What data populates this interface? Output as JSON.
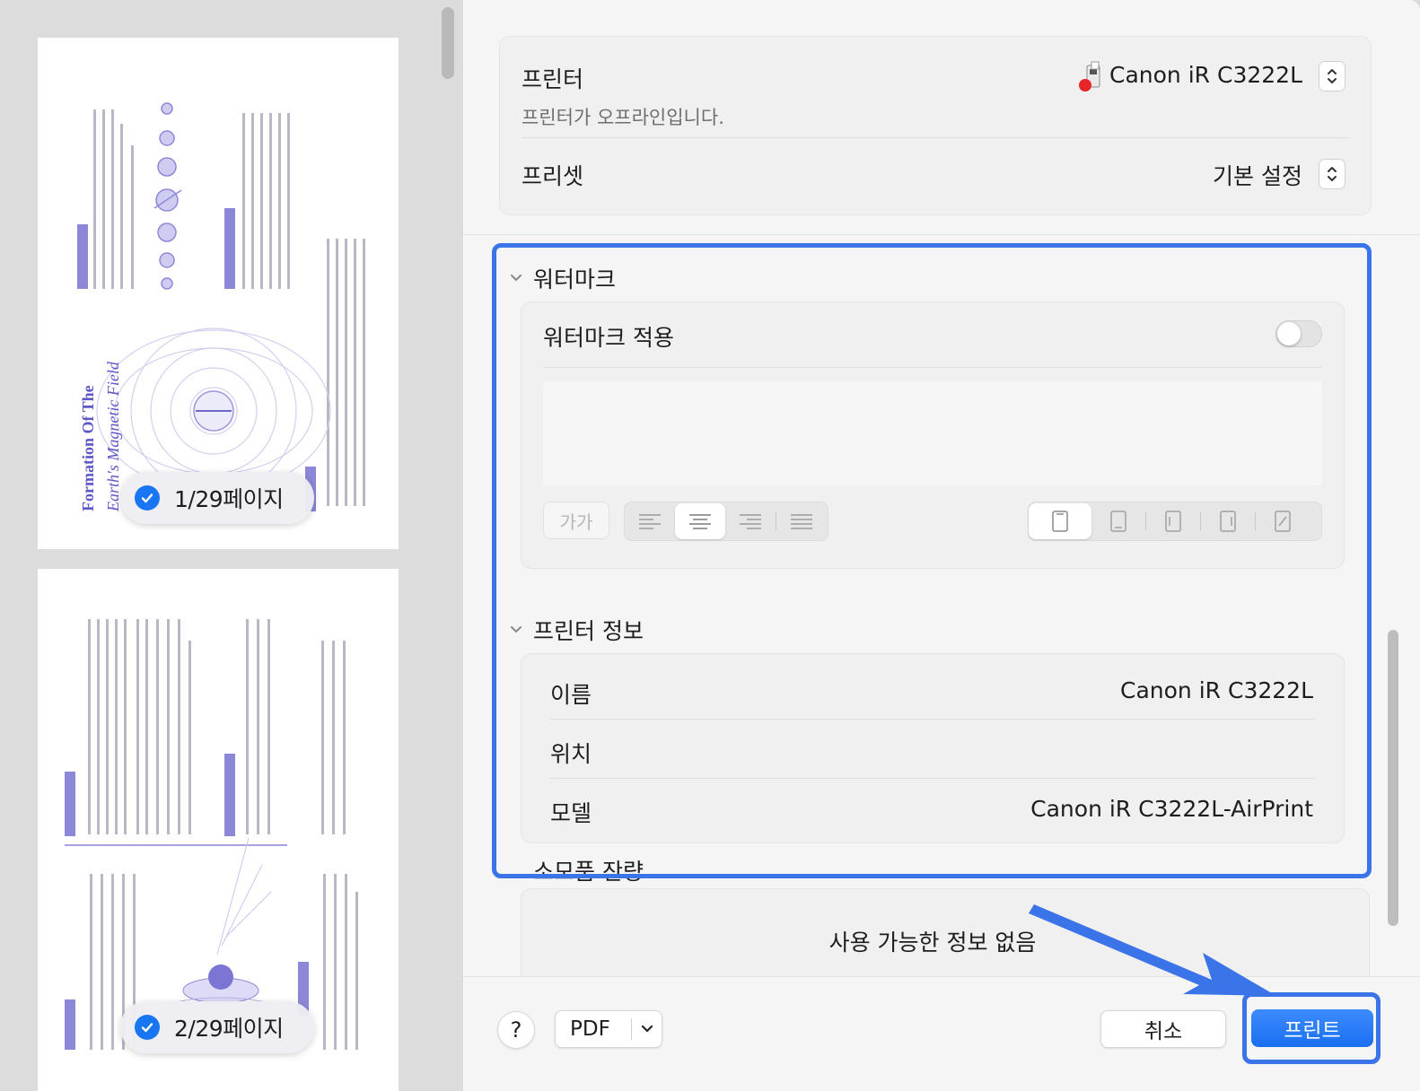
{
  "preview": {
    "pages": [
      {
        "title_line1": "Formation Of The",
        "title_line2": "Earth's Magnetic Field",
        "label": "1/29페이지",
        "checked": true
      },
      {
        "label": "2/29페이지",
        "checked": true
      }
    ]
  },
  "printer_settings": {
    "printer_label": "프린터",
    "printer_name": "Canon iR C3222L",
    "printer_status": "프린터가 오프라인입니다.",
    "preset_label": "프리셋",
    "preset_value": "기본 설정"
  },
  "watermark": {
    "section_title": "워터마크",
    "apply_label": "워터마크 적용",
    "apply_enabled": false,
    "font_button": "가가",
    "alignment_options": [
      "align-left-icon",
      "align-center-icon",
      "align-right-icon",
      "align-justify-icon"
    ],
    "alignment_selected": "align-center-icon",
    "position_options": [
      "page-portrait-icon",
      "page-bottom-icon",
      "page-left-icon",
      "page-right-icon",
      "page-diagonal-icon"
    ],
    "position_selected": "page-portrait-icon"
  },
  "printer_info": {
    "section_title": "프린터 정보",
    "rows": [
      {
        "label": "이름",
        "value": "Canon iR C3222L"
      },
      {
        "label": "위치",
        "value": ""
      },
      {
        "label": "모델",
        "value": "Canon iR C3222L-AirPrint"
      }
    ]
  },
  "supplies": {
    "section_title": "소모품 잔량",
    "empty_text": "사용 가능한 정보 없음"
  },
  "footer": {
    "help_label": "?",
    "pdf_label": "PDF",
    "cancel_label": "취소",
    "print_label": "프린트"
  },
  "colors": {
    "accent": "#1a6ff0",
    "highlight": "#3b73e8",
    "status_dot": "#e8262a"
  }
}
